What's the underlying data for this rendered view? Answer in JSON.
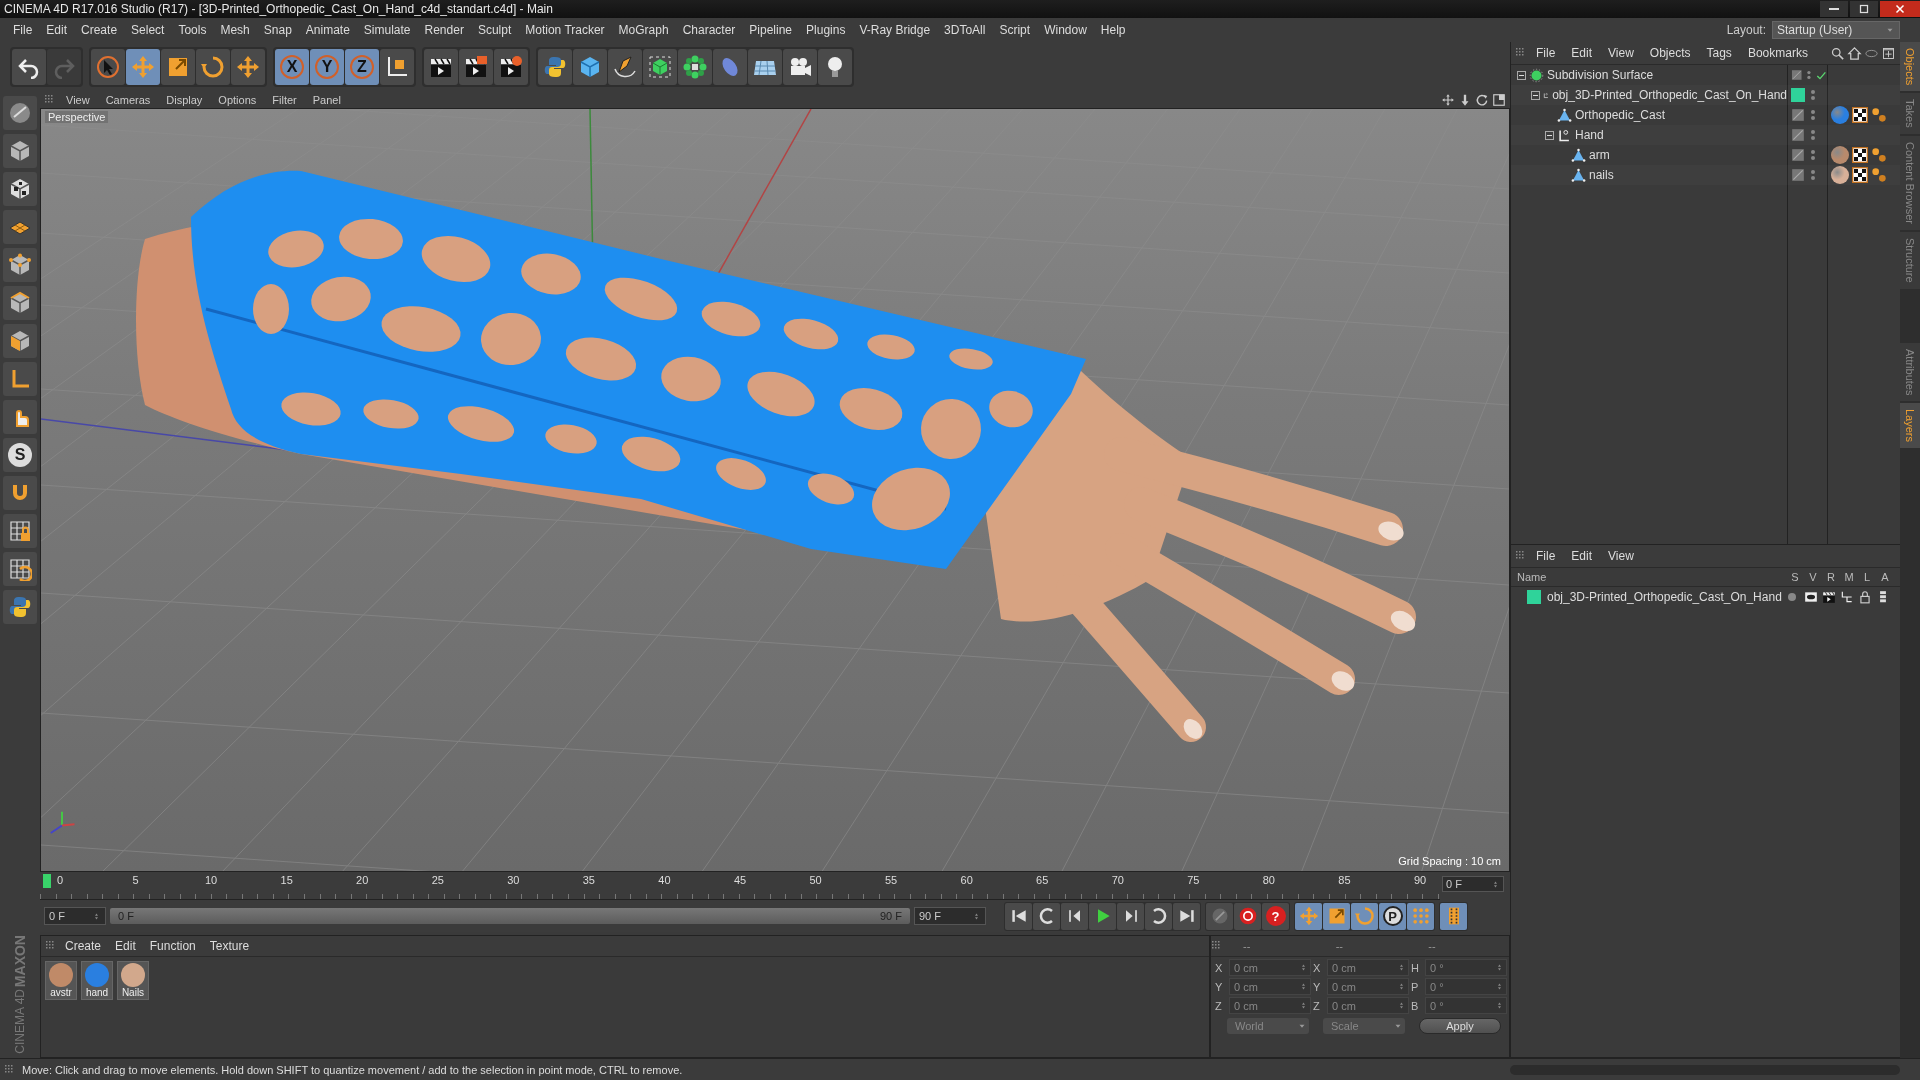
{
  "window": {
    "title": "CINEMA 4D R17.016 Studio (R17) - [3D-Printed_Orthopedic_Cast_On_Hand_c4d_standart.c4d] - Main"
  },
  "menu_bar": [
    "File",
    "Edit",
    "Create",
    "Select",
    "Tools",
    "Mesh",
    "Snap",
    "Animate",
    "Simulate",
    "Render",
    "Sculpt",
    "Motion Tracker",
    "MoGraph",
    "Character",
    "Pipeline",
    "Plugins",
    "V-Ray Bridge",
    "3DToAll",
    "Script",
    "Window",
    "Help"
  ],
  "layout": {
    "label": "Layout:",
    "value": "Startup (User)"
  },
  "main_toolbar": [
    {
      "selected": false,
      "disabled": false
    },
    {
      "selected": false,
      "disabled": true
    },
    {
      "selected": false,
      "disabled": false
    },
    {
      "selected": true,
      "disabled": false
    },
    {
      "selected": false,
      "disabled": false
    },
    {
      "selected": false,
      "disabled": false
    },
    {
      "selected": false,
      "disabled": false
    },
    {
      "selected": true,
      "disabled": false,
      "label": "X"
    },
    {
      "selected": true,
      "disabled": false,
      "label": "Y"
    },
    {
      "selected": true,
      "disabled": false,
      "label": "Z"
    },
    {
      "selected": false,
      "disabled": false
    },
    {
      "selected": false,
      "disabled": false
    },
    {
      "selected": false,
      "disabled": false
    },
    {
      "selected": false,
      "disabled": false
    },
    {
      "selected": false,
      "disabled": false
    },
    {
      "selected": false,
      "disabled": false
    },
    {
      "selected": false,
      "disabled": false
    },
    {
      "selected": false,
      "disabled": false
    },
    {
      "selected": false,
      "disabled": false
    },
    {
      "selected": false,
      "disabled": false
    },
    {
      "selected": false,
      "disabled": false
    },
    {
      "selected": false,
      "disabled": false
    },
    {
      "selected": false,
      "disabled": false
    }
  ],
  "left_toolbar": {
    "label": "S"
  },
  "viewport": {
    "menu": [
      "View",
      "Cameras",
      "Display",
      "Options",
      "Filter",
      "Panel"
    ],
    "camera": "Perspective",
    "grid_spacing": "Grid Spacing : 10 cm"
  },
  "timeline": {
    "ticks": [
      "0",
      "5",
      "10",
      "15",
      "20",
      "25",
      "30",
      "35",
      "40",
      "45",
      "50",
      "55",
      "60",
      "65",
      "70",
      "75",
      "80",
      "85",
      "90"
    ],
    "current_frame": "0 F",
    "playhead": {
      "level": 0
    }
  },
  "transport": {
    "start_field": "0 F",
    "range": {
      "start": "0 F",
      "end": "90 F",
      "level": 1
    },
    "end_field": "90 F",
    "buttons": [
      {
        "selected": false
      },
      {
        "selected": false
      },
      {
        "selected": false
      },
      {
        "selected": false
      },
      {
        "selected": false
      },
      {
        "selected": false
      },
      {
        "selected": false
      },
      {
        "selected": false
      },
      {
        "selected": false
      },
      {
        "selected": false,
        "label": "?"
      },
      {
        "selected": true
      },
      {
        "selected": true
      },
      {
        "selected": true
      },
      {
        "selected": true,
        "label": "P"
      },
      {
        "selected": true
      },
      {
        "selected": true
      }
    ]
  },
  "material_manager": {
    "menu": [
      "Create",
      "Edit",
      "Function",
      "Texture"
    ],
    "materials": [
      {
        "name": "avstr",
        "color": "#c08a68"
      },
      {
        "name": "hand",
        "color": "#2a7fe0"
      },
      {
        "name": "Nails",
        "color": "#d2a88c"
      }
    ]
  },
  "coordinates": {
    "headers": [
      "--",
      "--",
      "--"
    ],
    "rows": [
      {
        "label_1": "X",
        "value_1": "0 cm",
        "label_2": "X",
        "value_2": "0 cm",
        "label_3": "H",
        "value_3": "0 °"
      },
      {
        "label_1": "Y",
        "value_1": "0 cm",
        "label_2": "Y",
        "value_2": "0 cm",
        "label_3": "P",
        "value_3": "0 °"
      },
      {
        "label_1": "Z",
        "value_1": "0 cm",
        "label_2": "Z",
        "value_2": "0 cm",
        "label_3": "B",
        "value_3": "0 °"
      }
    ],
    "dropdowns": [
      "World",
      "Scale"
    ],
    "apply": "Apply"
  },
  "object_manager": {
    "menu": [
      "File",
      "Edit",
      "View",
      "Objects",
      "Tags",
      "Bookmarks"
    ],
    "objects": [
      {
        "name": "Subdivision Surface",
        "kind": "generator",
        "expanded": true,
        "enabled": true,
        "children": [
          {
            "name": "obj_3D-Printed_Orthopedic_Cast_On_Hand",
            "kind": "null",
            "expanded": true,
            "color": "#2fd39a",
            "children": [
              {
                "name": "Orthopedic_Cast",
                "kind": "polygon",
                "tags": [
                  {
                    "kind": "material",
                    "color": "#2a7fe0"
                  },
                  {
                    "kind": "checker"
                  },
                  {
                    "kind": "dots"
                  }
                ]
              },
              {
                "name": "Hand",
                "kind": "null",
                "expanded": true,
                "children": [
                  {
                    "name": "arm",
                    "kind": "polygon",
                    "tags": [
                      {
                        "kind": "material",
                        "color": "#b88a6c"
                      },
                      {
                        "kind": "checker"
                      },
                      {
                        "kind": "dots"
                      }
                    ]
                  },
                  {
                    "name": "nails",
                    "kind": "polygon",
                    "tags": [
                      {
                        "kind": "material",
                        "color": "#d8b098"
                      },
                      {
                        "kind": "checker"
                      },
                      {
                        "kind": "dots"
                      }
                    ]
                  }
                ]
              }
            ]
          }
        ]
      }
    ]
  },
  "layer_manager": {
    "menu": [
      "File",
      "Edit",
      "View"
    ],
    "columns": [
      "Name",
      "S",
      "V",
      "R",
      "M",
      "L",
      "A"
    ],
    "layers": [
      {
        "name": "obj_3D-Printed_Orthopedic_Cast_On_Hand",
        "color": "#2fd39a"
      }
    ]
  },
  "side_tabs_top": [
    {
      "label": "Objects",
      "selected": true
    },
    {
      "label": "Takes",
      "selected": false
    },
    {
      "label": "Content Browser",
      "selected": false
    },
    {
      "label": "Structure",
      "selected": false
    }
  ],
  "side_tabs_bottom": [
    {
      "label": "Attributes",
      "selected": false
    },
    {
      "label": "Layers",
      "selected": true
    }
  ],
  "logo": {
    "brand": "MAXON",
    "product": "CINEMA 4D"
  },
  "status_bar": "Move: Click and drag to move elements. Hold down SHIFT to quantize movement / add to the selection in point mode, CTRL to remove."
}
